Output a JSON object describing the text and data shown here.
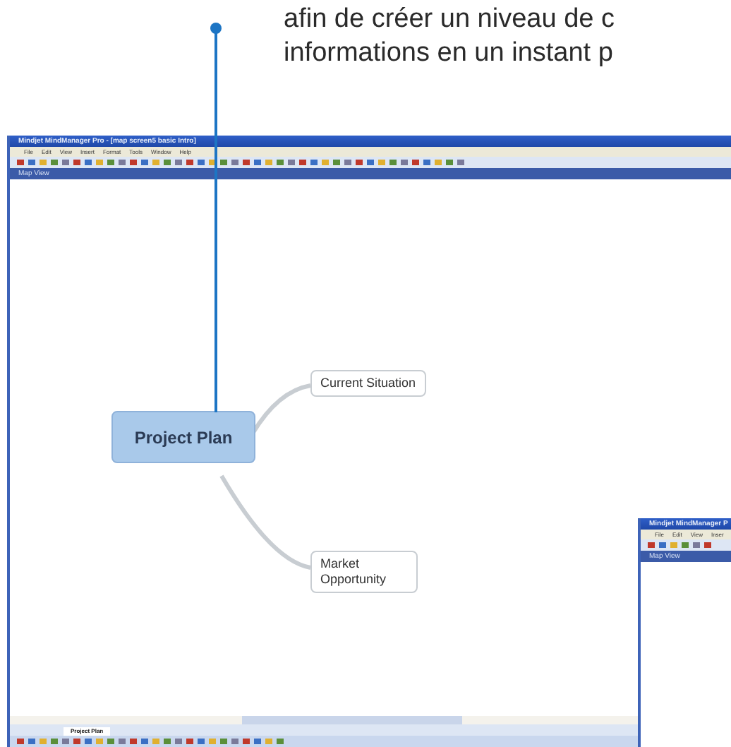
{
  "intro_text": {
    "lines": [
      "afin de créer un niveau de c",
      "informations en un instant p"
    ]
  },
  "window": {
    "title": "Mindjet MindManager Pro - [map screen5 basic Intro]",
    "menu": [
      "File",
      "Edit",
      "View",
      "Insert",
      "Format",
      "Tools",
      "Window",
      "Help"
    ],
    "view_bar": "Map View",
    "map": {
      "central": "Project Plan",
      "topics": [
        "Current Situation",
        "Market Opportunity"
      ]
    },
    "tabs": [
      {
        "label": "Project Plan",
        "selected": true
      }
    ]
  },
  "second_window": {
    "title": "Mindjet MindManager P",
    "menu": [
      "File",
      "Edit",
      "View",
      "Inser"
    ],
    "view_bar": "Map View"
  }
}
